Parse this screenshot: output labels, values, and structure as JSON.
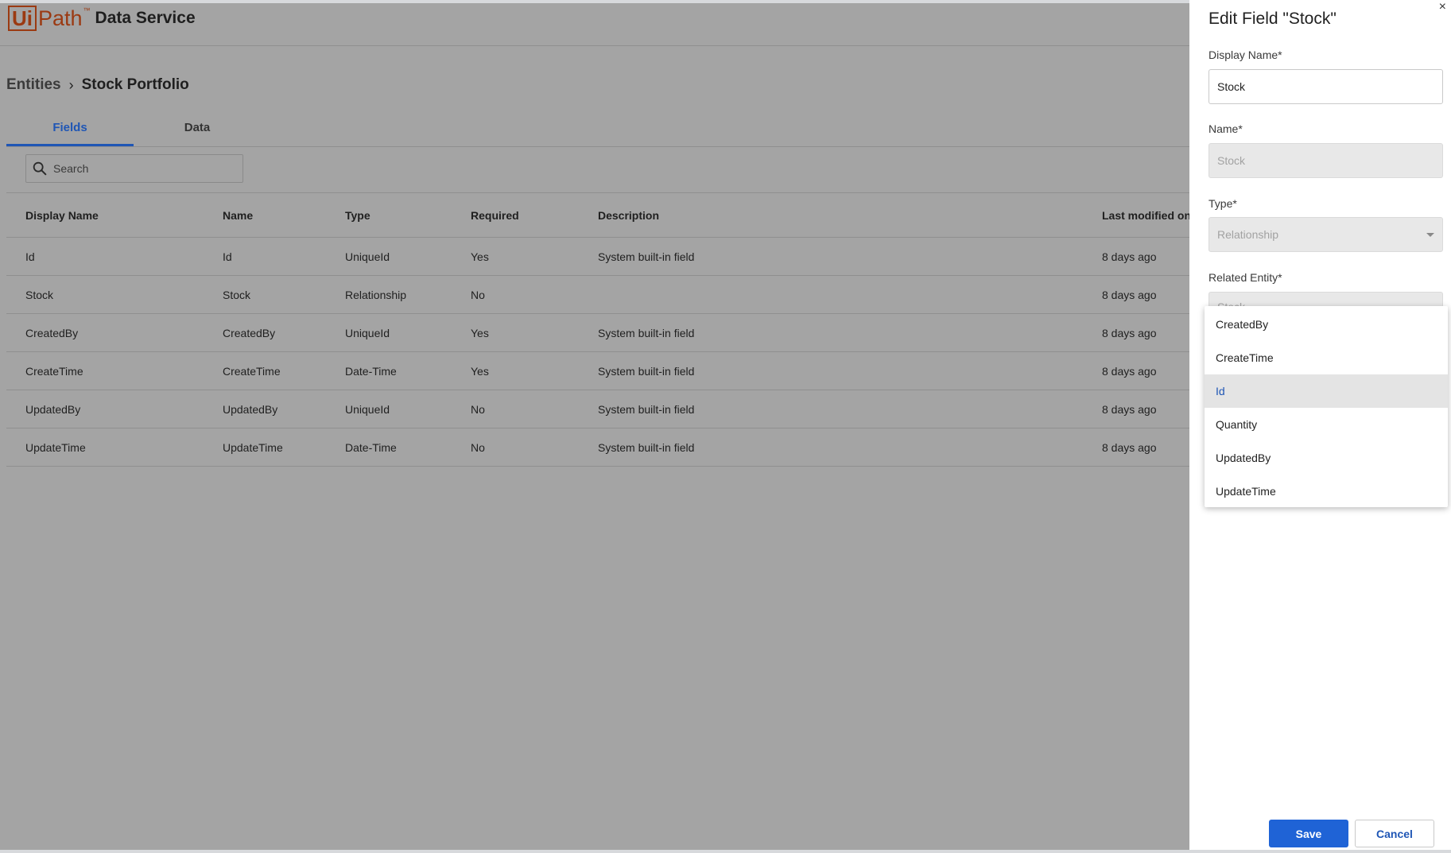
{
  "app": {
    "logo_box": "Ui",
    "logo_path": "Path",
    "logo_tm": "™",
    "product": "Data Service"
  },
  "breadcrumb": {
    "root": "Entities",
    "separator": "›",
    "current": "Stock Portfolio"
  },
  "tabs": [
    {
      "label": "Fields",
      "active": true
    },
    {
      "label": "Data",
      "active": false
    }
  ],
  "search": {
    "placeholder": "Search"
  },
  "table": {
    "headers": [
      "Display Name",
      "Name",
      "Type",
      "Required",
      "Description",
      "Last modified on"
    ],
    "rows": [
      [
        "Id",
        "Id",
        "UniqueId",
        "Yes",
        "System built-in field",
        "8 days ago"
      ],
      [
        "Stock",
        "Stock",
        "Relationship",
        "No",
        "",
        "8 days ago"
      ],
      [
        "CreatedBy",
        "CreatedBy",
        "UniqueId",
        "Yes",
        "System built-in field",
        "8 days ago"
      ],
      [
        "CreateTime",
        "CreateTime",
        "Date-Time",
        "Yes",
        "System built-in field",
        "8 days ago"
      ],
      [
        "UpdatedBy",
        "UpdatedBy",
        "UniqueId",
        "No",
        "System built-in field",
        "8 days ago"
      ],
      [
        "UpdateTime",
        "UpdateTime",
        "Date-Time",
        "No",
        "System built-in field",
        "8 days ago"
      ]
    ]
  },
  "panel": {
    "title": "Edit Field \"Stock\"",
    "close": "×",
    "display_name": {
      "label": "Display Name*",
      "value": "Stock"
    },
    "name": {
      "label": "Name*",
      "value": "Stock"
    },
    "type": {
      "label": "Type*",
      "value": "Relationship"
    },
    "related_entity": {
      "label": "Related Entity*",
      "value": "Stock"
    },
    "dropdown": {
      "options": [
        "CreatedBy",
        "CreateTime",
        "Id",
        "Quantity",
        "UpdatedBy",
        "UpdateTime"
      ],
      "highlighted": "Id"
    },
    "save_label": "Save",
    "cancel_label": "Cancel"
  },
  "colors": {
    "brand": "#9b3a12",
    "accent": "#1f56b5",
    "primary_button": "#1f63d6",
    "overlay": "#a4a4a4"
  }
}
